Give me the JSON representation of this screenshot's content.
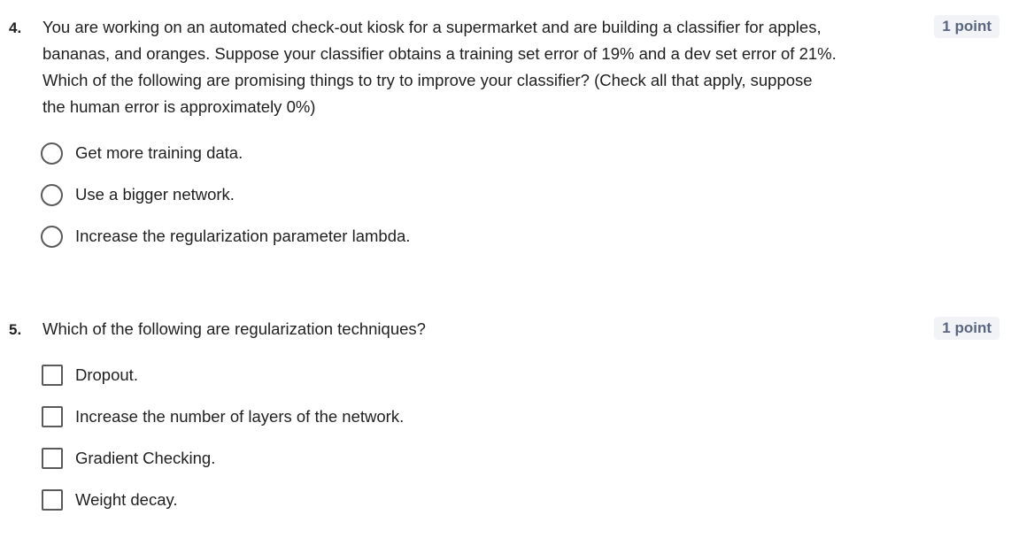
{
  "questions": [
    {
      "number": "4.",
      "text": "You are working on an automated check-out kiosk for a supermarket and are building a classifier for apples, bananas, and oranges. Suppose your classifier obtains a training set error of 19% and a dev set error of 21%. Which of the following are promising things to try to improve your classifier? (Check all that apply, suppose the human error is approximately 0%)",
      "points": "1 point",
      "input_type": "radio",
      "options": [
        "Get more training data.",
        "Use a bigger network.",
        "Increase the regularization parameter lambda."
      ]
    },
    {
      "number": "5.",
      "text": "Which of the following are regularization techniques?",
      "points": "1 point",
      "input_type": "checkbox",
      "options": [
        "Dropout.",
        "Increase the number of layers of the network.",
        "Gradient Checking.",
        "Weight decay."
      ]
    }
  ]
}
